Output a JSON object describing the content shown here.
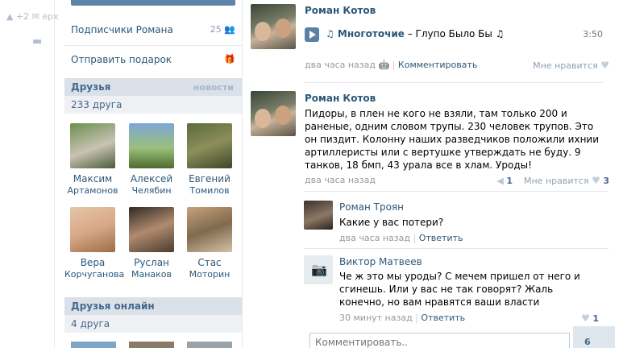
{
  "leftbar": {
    "up_label": "+2",
    "up_text": "ерх"
  },
  "sidebar": {
    "subscribers_label": "Подписчики Романа",
    "subscribers_count": "25",
    "gift_label": "Отправить подарок",
    "friends": {
      "title": "Друзья",
      "news_link": "новости",
      "count": "233 друга",
      "items": [
        {
          "first": "Максим",
          "last": "Артамонов"
        },
        {
          "first": "Алексей",
          "last": "Челябин"
        },
        {
          "first": "Евгений",
          "last": "Томилов"
        },
        {
          "first": "Вера",
          "last": "Корчуганова"
        },
        {
          "first": "Руслан",
          "last": "Манаков"
        },
        {
          "first": "Стас",
          "last": "Моторин"
        }
      ]
    },
    "online": {
      "title": "Друзья онлайн",
      "count": "4 друга"
    }
  },
  "feed": {
    "post1": {
      "author": "Роман Котов",
      "audio_artist": "♫ Многоточие",
      "audio_title": " – Глупо Было Бы ♫",
      "duration": "3:50",
      "time": "два часа назад",
      "comment_link": "Комментировать",
      "like_label": "Мне нравится"
    },
    "post2": {
      "author": "Роман Котов",
      "text": "Пидоры, в плен не кого не взяли, там только 200 и раненые, одним словом трупы. 230 человек трупов. Это он пиздит. Колонну наших разведчиков положили ихнии артиллеристы или с вертушке утверждать не буду. 9 танков, 18 бмп, 43 урала все в хлам. Уроды!",
      "time": "два часа назад",
      "reposts": "1",
      "like_label": "Мне нравится",
      "likes": "3"
    },
    "replies": [
      {
        "name": "Роман Троян",
        "text": "Какие у вас потери?",
        "time": "два часа назад",
        "reply_link": "Ответить"
      },
      {
        "name": "Виктор Матвеев",
        "text": "Че ж это мы уроды? С мечем пришел от него и сгинешь. Или у вас не так говорят? Жаль конечно, но вам нравятся ваши власти",
        "time": "30 минут назад",
        "reply_link": "Ответить",
        "likes": "1"
      }
    ],
    "comment_placeholder": "Комментировать..",
    "notif_count": "6"
  },
  "colors": {
    "link": "#2b587a",
    "header_bg": "#dae1e8",
    "accent": "#5b7fa6"
  }
}
